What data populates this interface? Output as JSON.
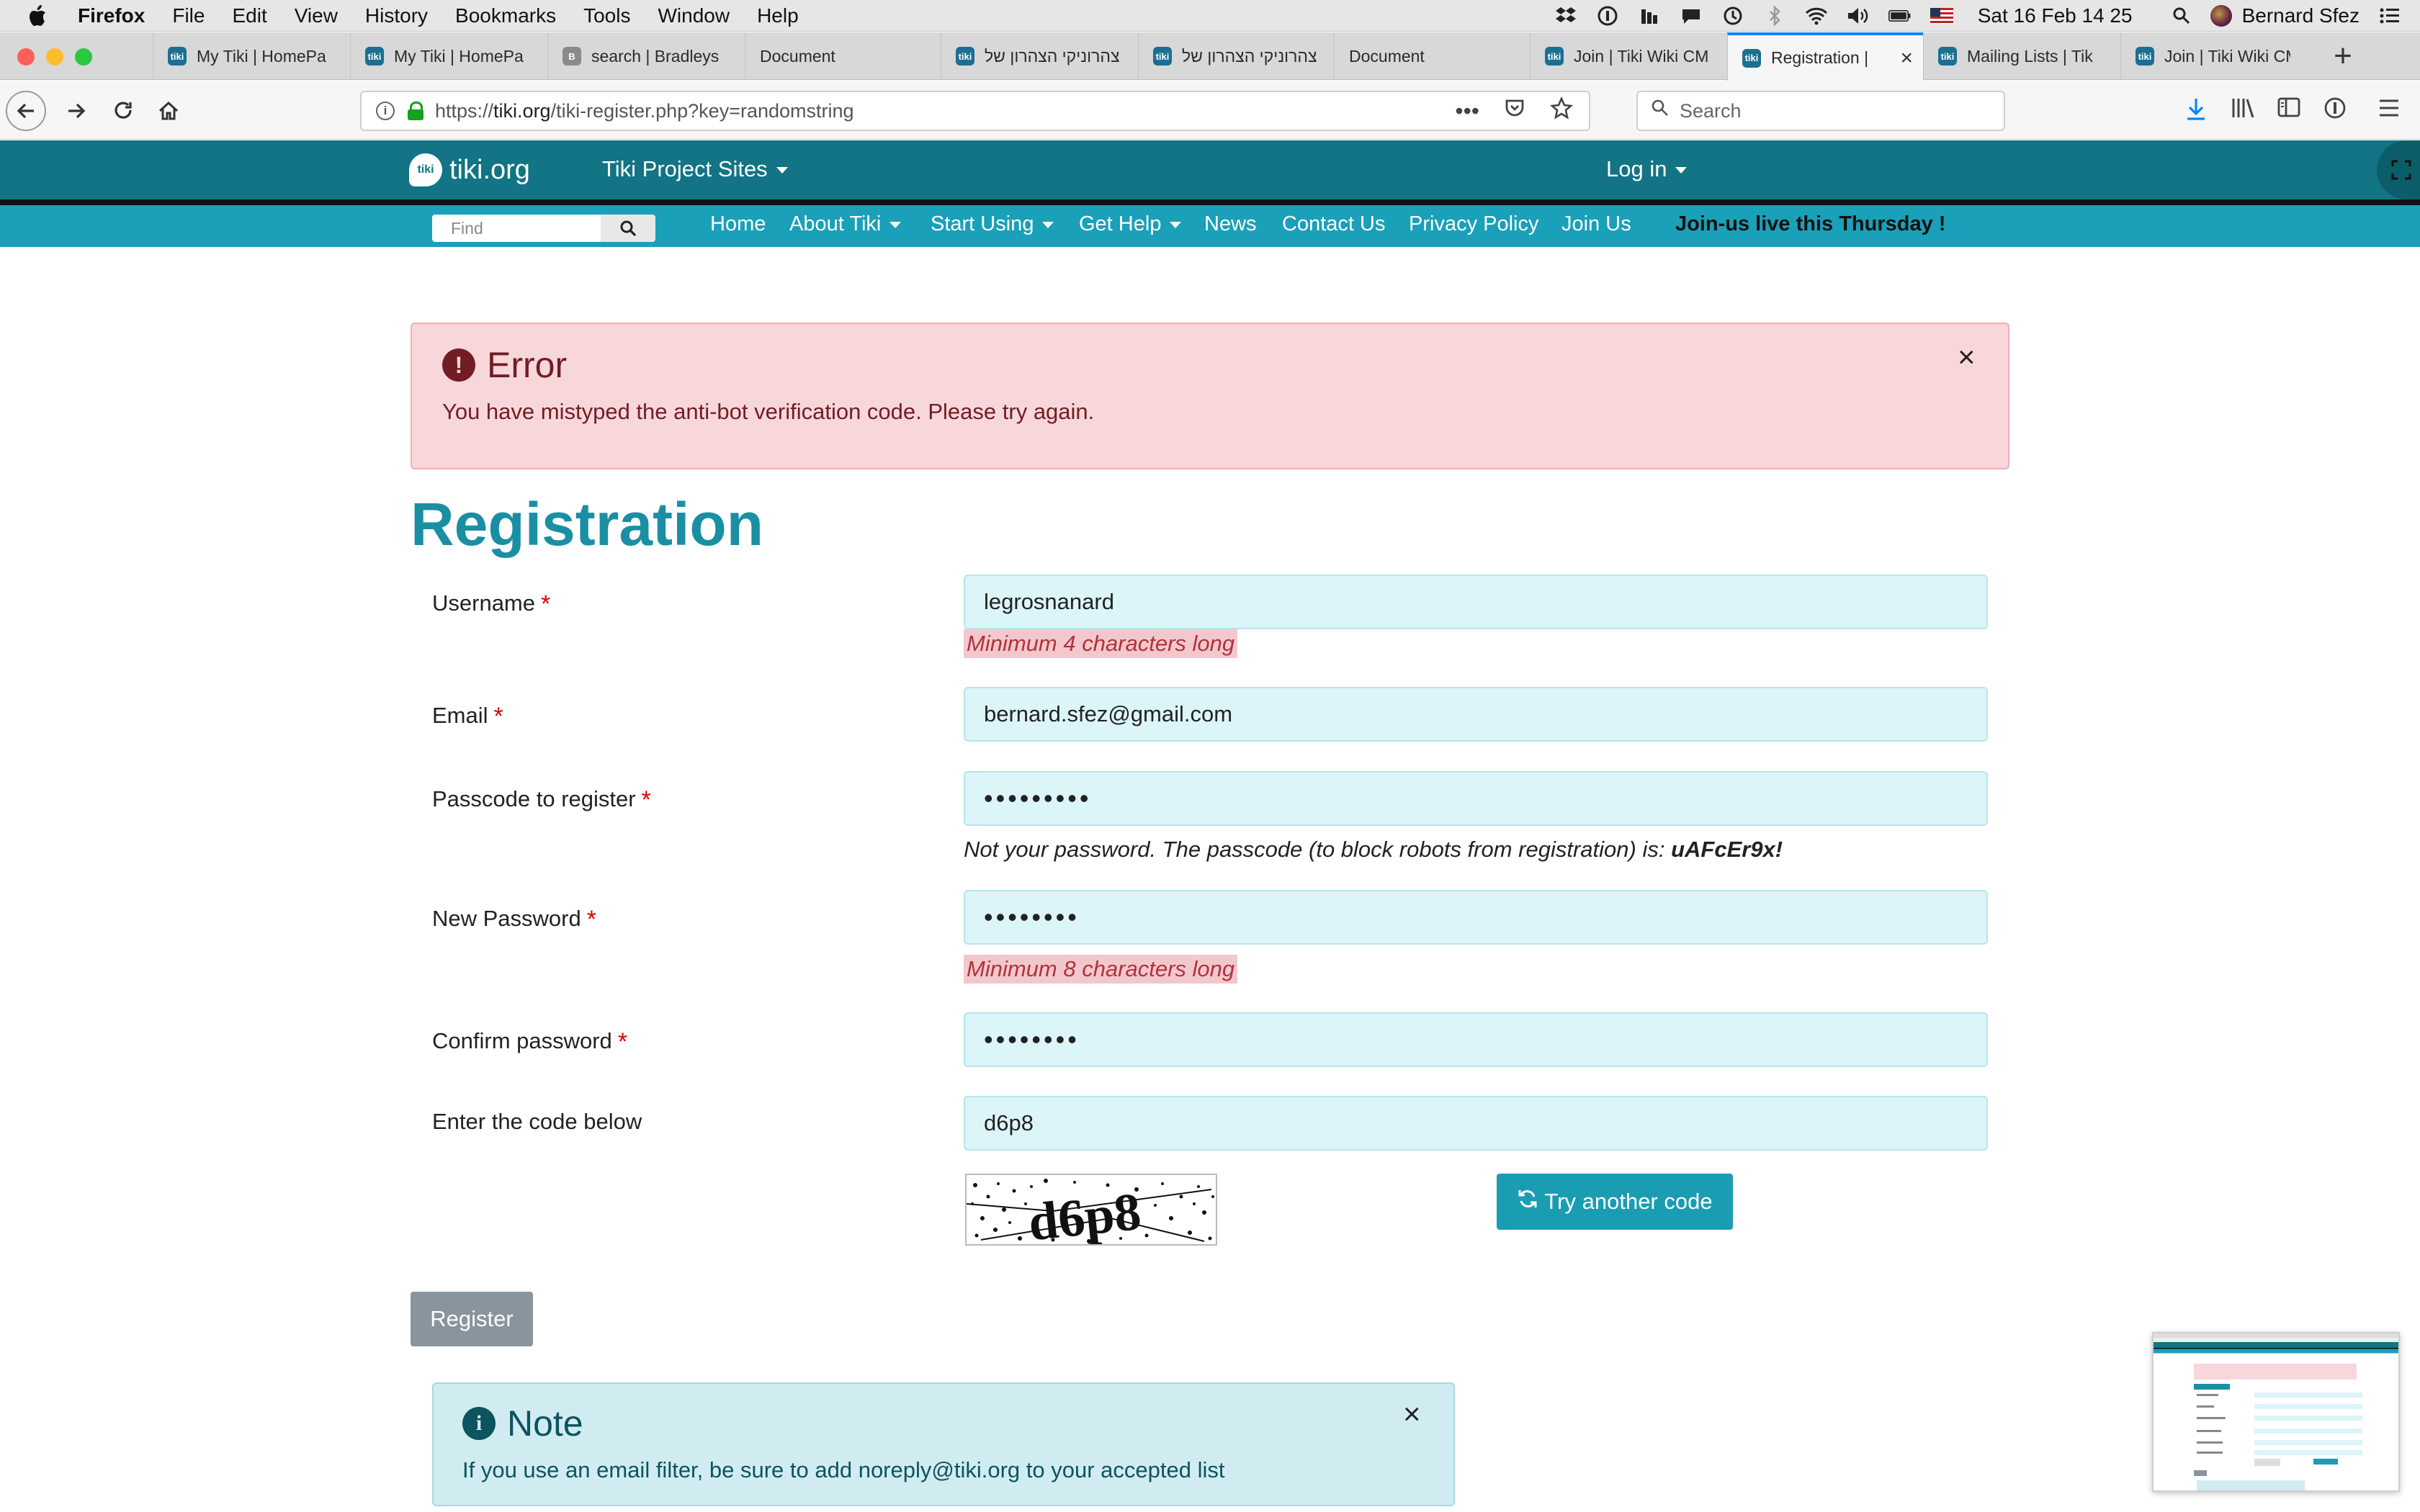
{
  "menubar": {
    "app_name": "Firefox",
    "items": [
      "File",
      "Edit",
      "View",
      "History",
      "Bookmarks",
      "Tools",
      "Window",
      "Help"
    ],
    "clock": "Sat 16 Feb  14 25",
    "user": "Bernard Sfez",
    "status_icons": [
      "dropbox-icon",
      "1password-icon",
      "stats-icon",
      "notification-icon",
      "time-machine-icon",
      "bluetooth-icon",
      "wifi-icon",
      "volume-icon",
      "battery-icon",
      "us-flag-icon"
    ]
  },
  "tabs": [
    {
      "label": "My Tiki | HomePa",
      "icon": "tiki"
    },
    {
      "label": "My Tiki | HomePa",
      "icon": "tiki"
    },
    {
      "label": "search | Bradleys",
      "icon": "b"
    },
    {
      "label": "Document",
      "icon": "none"
    },
    {
      "label": "צהרוניקי הצהרון של",
      "icon": "tiki"
    },
    {
      "label": "צהרוניקי הצהרון של",
      "icon": "tiki"
    },
    {
      "label": "Document",
      "icon": "none"
    },
    {
      "label": "Join | Tiki Wiki CM",
      "icon": "tiki"
    },
    {
      "label": "Registration |",
      "icon": "tiki",
      "active": true
    },
    {
      "label": "Mailing Lists | Tik",
      "icon": "tiki"
    },
    {
      "label": "Join | Tiki Wiki CM",
      "icon": "tiki"
    }
  ],
  "toolbar": {
    "url_prefix": "https://",
    "url_domain": "tiki.org",
    "url_path": "/tiki-register.php?key=randomstring",
    "search_placeholder": "Search"
  },
  "site": {
    "logo_text": "tiki.org",
    "project_sites": "Tiki Project Sites",
    "login": "Log in",
    "find_placeholder": "Find",
    "nav": [
      "Home",
      "About Tiki",
      "Start Using",
      "Get Help",
      "News",
      "Contact Us",
      "Privacy Policy",
      "Join Us"
    ],
    "promo": "Join-us live this Thursday !"
  },
  "error_alert": {
    "title": "Error",
    "message": "You have mistyped the anti-bot verification code. Please try again."
  },
  "form": {
    "title": "Registration",
    "username_label": "Username",
    "username_value": "legrosnanard",
    "username_hint": "Minimum 4 characters long",
    "email_label": "Email",
    "email_value": "bernard.sfez@gmail.com",
    "passcode_label": "Passcode to register",
    "passcode_value": "•••••••••",
    "passcode_hint_prefix": "Not your password. The passcode (to block robots from registration) is: ",
    "passcode_hint_code": "uAFcEr9x!",
    "new_password_label": "New Password",
    "new_password_value": "••••••••",
    "new_password_hint": "Minimum 8 characters long",
    "confirm_label": "Confirm password",
    "confirm_value": "••••••••",
    "code_label": "Enter the code below",
    "code_value": "d6p8",
    "captcha_text": "d6p8",
    "refresh_label": "Try another code",
    "required_mark": "*",
    "register_label": "Register"
  },
  "note_alert": {
    "title": "Note",
    "message": "If you use an email filter, be sure to add noreply@tiki.org to your accepted list"
  },
  "colors": {
    "site_header": "#127484",
    "nav_bar": "#1aa0b9",
    "title_teal": "#1a8fa4",
    "error_bg": "#f8d7da",
    "note_bg": "#d1ecf1",
    "input_bg": "#dcf5f8"
  }
}
